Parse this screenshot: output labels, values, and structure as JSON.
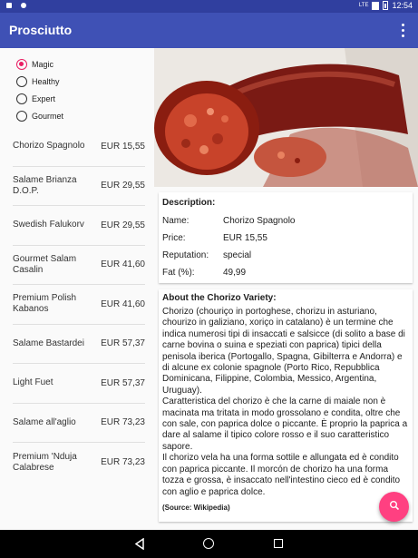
{
  "status_bar": {
    "time": "12:54",
    "network": "LTE",
    "left_icons": [
      "notification-icon",
      "settings-notification-icon"
    ]
  },
  "app_bar": {
    "title": "Prosciutto",
    "overflow_icon": "more-vert-icon"
  },
  "filters": [
    {
      "label": "Magic",
      "checked": true
    },
    {
      "label": "Healthy",
      "checked": false
    },
    {
      "label": "Expert",
      "checked": false
    },
    {
      "label": "Gourmet",
      "checked": false
    }
  ],
  "items": [
    {
      "name": "Chorizo Spagnolo",
      "price": "EUR 15,55"
    },
    {
      "name": "Salame Brianza D.O.P.",
      "price": "EUR 29,55"
    },
    {
      "name": "Swedish Falukorv",
      "price": "EUR 29,55"
    },
    {
      "name": "Gourmet Salam Casalin",
      "price": "EUR 41,60"
    },
    {
      "name": "Premium Polish Kabanos",
      "price": "EUR 41,60"
    },
    {
      "name": "Salame Bastardei",
      "price": "EUR 57,37"
    },
    {
      "name": "Light Fuet",
      "price": "EUR 57,37"
    },
    {
      "name": "Salame all'aglio",
      "price": "EUR 73,23"
    },
    {
      "name": "Premium 'Nduja Calabrese",
      "price": "EUR 73,23"
    }
  ],
  "details": {
    "heading": "Description:",
    "rows": [
      {
        "label": "Name:",
        "value": "Chorizo Spagnolo"
      },
      {
        "label": "Price:",
        "value": "EUR 15,55"
      },
      {
        "label": "Reputation:",
        "value": "special"
      },
      {
        "label": "Fat (%):",
        "value": "49,99"
      }
    ]
  },
  "about": {
    "heading": "About the Chorizo Variety:",
    "text": "Chorizo (chouriço in portoghese, chorizu in asturiano, chourizo in galiziano, xoriço in catalano) è un termine che indica numerosi tipi di insaccati e salsicce (di solito a base di carne bovina o suina e speziati con paprica) tipici della penisola iberica (Portogallo, Spagna, Gibilterra e Andorra) e di alcune ex colonie spagnole (Porto Rico, Repubblica Dominicana, Filippine, Colombia, Messico, Argentina, Uruguay).\nCaratteristica del chorizo è che la carne di maiale non è macinata ma tritata in modo grossolano e condita, oltre che con sale, con paprica dolce o piccante. È proprio la paprica a dare al salame il tipico colore rosso e il suo caratteristico sapore.\nIl chorizo vela ha una forma sottile e allungata ed è condito con paprica piccante. Il morcón de chorizo ha una forma tozza e grossa, è insaccato nell'intestino cieco ed è condito con aglio e paprica dolce.",
    "source": "(Source: Wikipedia)"
  },
  "fab": {
    "icon": "search-icon"
  },
  "colors": {
    "primary": "#3f51b5",
    "primary_dark": "#303f9f",
    "accent": "#ff4081",
    "radio_checked": "#e91e63"
  }
}
